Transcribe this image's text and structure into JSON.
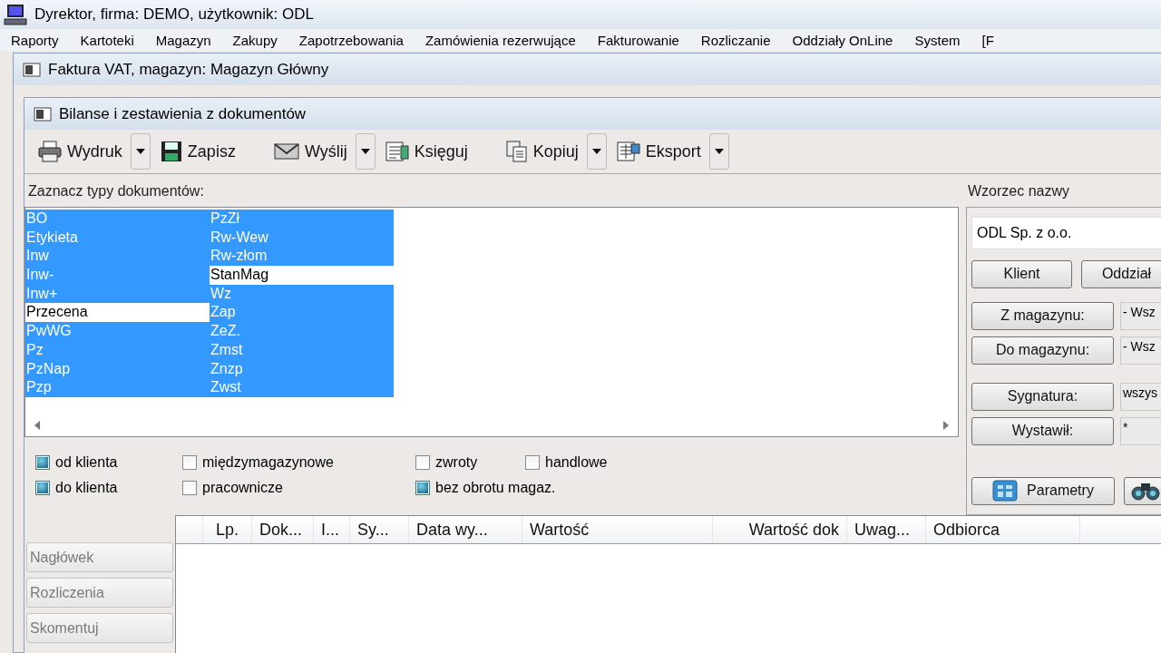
{
  "app_title": "Dyrektor, firma: DEMO, użytkownik: ODL",
  "menu": [
    "Raporty",
    "Kartoteki",
    "Magazyn",
    "Zakupy",
    "Zapotrzebowania",
    "Zamówienia rezerwujące",
    "Fakturowanie",
    "Rozliczanie",
    "Oddziały OnLine",
    "System",
    "[F"
  ],
  "invoice_window": {
    "title": "Faktura VAT, magazyn: Magazyn Główny"
  },
  "report_window": {
    "title": "Bilanse i zestawienia z dokumentów",
    "toolbar": [
      {
        "label": "Wydruk",
        "kind": "printer",
        "dropdown": true
      },
      {
        "label": "Zapisz",
        "kind": "save",
        "dropdown": false
      },
      {
        "label": "Wyślij",
        "kind": "send",
        "dropdown": true
      },
      {
        "label": "Księguj",
        "kind": "post",
        "dropdown": false
      },
      {
        "label": "Kopiuj",
        "kind": "copy",
        "dropdown": true
      },
      {
        "label": "Eksport",
        "kind": "export",
        "dropdown": true
      }
    ]
  },
  "document_types": {
    "label": "Zaznacz typy dokumentów:",
    "items": [
      {
        "label": "BO",
        "selected": true
      },
      {
        "label": "Etykieta",
        "selected": true
      },
      {
        "label": "Inw",
        "selected": true
      },
      {
        "label": "Inw-",
        "selected": true
      },
      {
        "label": "Inw+",
        "selected": true
      },
      {
        "label": "Przecena",
        "selected": false
      },
      {
        "label": "PwWG",
        "selected": true
      },
      {
        "label": "Pz",
        "selected": true
      },
      {
        "label": "PzNap",
        "selected": true
      },
      {
        "label": "Pzp",
        "selected": true
      },
      {
        "label": "PzZł",
        "selected": true
      },
      {
        "label": "Rw-Wew",
        "selected": true
      },
      {
        "label": "Rw-złom",
        "selected": true
      },
      {
        "label": "StanMag",
        "selected": false
      },
      {
        "label": "Wz",
        "selected": true
      },
      {
        "label": "Zap",
        "selected": true
      },
      {
        "label": "ZeZ.",
        "selected": true
      },
      {
        "label": "Zmst",
        "selected": true
      },
      {
        "label": "Znzp",
        "selected": true
      },
      {
        "label": "Zwst",
        "selected": true
      }
    ]
  },
  "filters": [
    {
      "label": "od klienta",
      "checked": true
    },
    {
      "label": "międzymagazynowe",
      "checked": false
    },
    {
      "label": "zwroty",
      "checked": false
    },
    {
      "label": "handlowe",
      "checked": false
    },
    {
      "label": "do klienta",
      "checked": true
    },
    {
      "label": "pracownicze",
      "checked": false
    },
    {
      "label": "bez obrotu magaz.",
      "checked": true
    }
  ],
  "name_pattern": {
    "label": "Wzorzec nazwy",
    "value": "ODL Sp. z o.o.",
    "buttons": [
      "Klient",
      "Oddział"
    ],
    "fields": [
      {
        "button": "Z magazynu:",
        "value": "- Wsz"
      },
      {
        "button": "Do magazynu:",
        "value": "- Wsz"
      },
      {
        "button": "Sygnatura:",
        "value": "wszys"
      },
      {
        "button": "Wystawił:",
        "value": "*"
      }
    ],
    "actions": [
      {
        "kind": "parameters",
        "label": "Parametry"
      },
      {
        "kind": "search"
      }
    ]
  },
  "side_buttons": [
    {
      "label": "Nagłówek",
      "disabled": true
    },
    {
      "label": "Rozliczenia",
      "disabled": true
    },
    {
      "label": "Skomentuj",
      "disabled": true
    }
  ],
  "table": {
    "columns": [
      "Lp.",
      "Dok...",
      "I...",
      "Sy...",
      "Data wy...",
      "Wartość",
      "Wartość dok",
      "Uwag...",
      "Odbiorca"
    ]
  }
}
